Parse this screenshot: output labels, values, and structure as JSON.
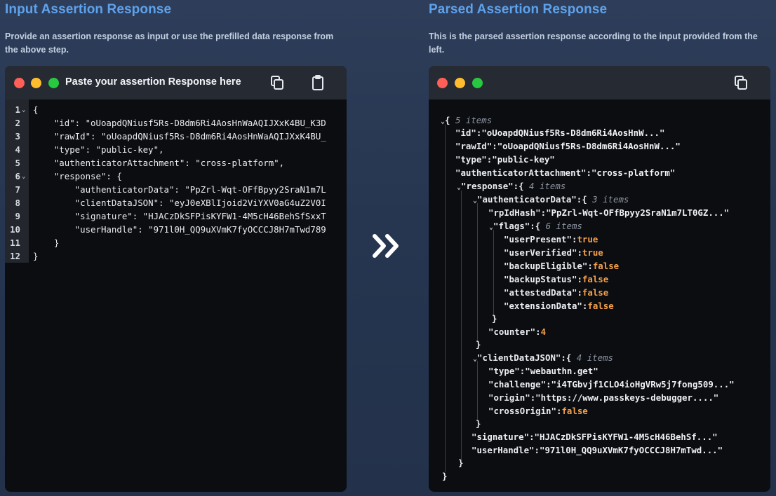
{
  "left": {
    "title": "Input Assertion Response",
    "description_line1": "Provide an assertion response as input or use the prefilled data response from",
    "description_line2": "the above step.",
    "window_title": "Paste your assertion Response here",
    "icons": [
      "copy-icon",
      "clipboard-icon"
    ],
    "lines": [
      {
        "n": "1",
        "text": "{"
      },
      {
        "n": "2",
        "text": "    \"id\": \"oUoapdQNiusf5Rs-D8dm6Ri4AosHnWaAQIJXxK4BU_K3D"
      },
      {
        "n": "3",
        "text": "    \"rawId\": \"oUoapdQNiusf5Rs-D8dm6Ri4AosHnWaAQIJXxK4BU_"
      },
      {
        "n": "4",
        "text": "    \"type\": \"public-key\","
      },
      {
        "n": "5",
        "text": "    \"authenticatorAttachment\": \"cross-platform\","
      },
      {
        "n": "6",
        "text": "    \"response\": {"
      },
      {
        "n": "7",
        "text": "        \"authenticatorData\": \"PpZrl-Wqt-OFfBpyy2SraN1m7L"
      },
      {
        "n": "8",
        "text": "        \"clientDataJSON\": \"eyJ0eXBlIjoid2ViYXV0aG4uZ2V0I"
      },
      {
        "n": "9",
        "text": "        \"signature\": \"HJACzDkSFPisKYFW1-4M5cH46BehSfSxxT"
      },
      {
        "n": "10",
        "text": "        \"userHandle\": \"971l0H_QQ9uXVmK7fyOCCCJ8H7mTwd789"
      },
      {
        "n": "11",
        "text": "    }"
      },
      {
        "n": "12",
        "text": "}"
      }
    ]
  },
  "right": {
    "title": "Parsed Assertion Response",
    "description_line1": "This is the parsed assertion response according to the input provided from the",
    "description_line2": "left.",
    "icons": [
      "copy-icon"
    ],
    "tree": {
      "root_count": "5 items",
      "id_key": "\"id\"",
      "id_val": "\"oUoapdQNiusf5Rs-D8dm6Ri4AosHnW...\"",
      "rawId_key": "\"rawId\"",
      "rawId_val": "\"oUoapdQNiusf5Rs-D8dm6Ri4AosHnW...\"",
      "type_key": "\"type\"",
      "type_val": "\"public-key\"",
      "att_key": "\"authenticatorAttachment\"",
      "att_val": "\"cross-platform\"",
      "response_key": "\"response\"",
      "response_count": "4 items",
      "authData_key": "\"authenticatorData\"",
      "authData_count": "3 items",
      "rpIdHash_key": "\"rpIdHash\"",
      "rpIdHash_val": "\"PpZrl-Wqt-OFfBpyy2SraN1m7LT0GZ...\"",
      "flags_key": "\"flags\"",
      "flags_count": "6 items",
      "userPresent_key": "\"userPresent\"",
      "userPresent_val": "true",
      "userVerified_key": "\"userVerified\"",
      "userVerified_val": "true",
      "backupEligible_key": "\"backupEligible\"",
      "backupEligible_val": "false",
      "backupStatus_key": "\"backupStatus\"",
      "backupStatus_val": "false",
      "attestedData_key": "\"attestedData\"",
      "attestedData_val": "false",
      "extensionData_key": "\"extensionData\"",
      "extensionData_val": "false",
      "counter_key": "\"counter\"",
      "counter_val": "4",
      "cdj_key": "\"clientDataJSON\"",
      "cdj_count": "4 items",
      "cdj_type_key": "\"type\"",
      "cdj_type_val": "\"webauthn.get\"",
      "challenge_key": "\"challenge\"",
      "challenge_val": "\"i4TGbvjf1CLO4ioHgVRw5j7fong509...\"",
      "origin_key": "\"origin\"",
      "origin_val": "\"https://www.passkeys-debugger....\"",
      "crossOrigin_key": "\"crossOrigin\"",
      "crossOrigin_val": "false",
      "signature_key": "\"signature\"",
      "signature_val": "\"HJACzDkSFPisKYFW1-4M5cH46BehSf...\"",
      "userHandle_key": "\"userHandle\"",
      "userHandle_val": "\"971l0H_QQ9uXVmK7fyOCCCJ8H7mTwd...\""
    }
  },
  "center_icon": "double-chevron-right-icon"
}
